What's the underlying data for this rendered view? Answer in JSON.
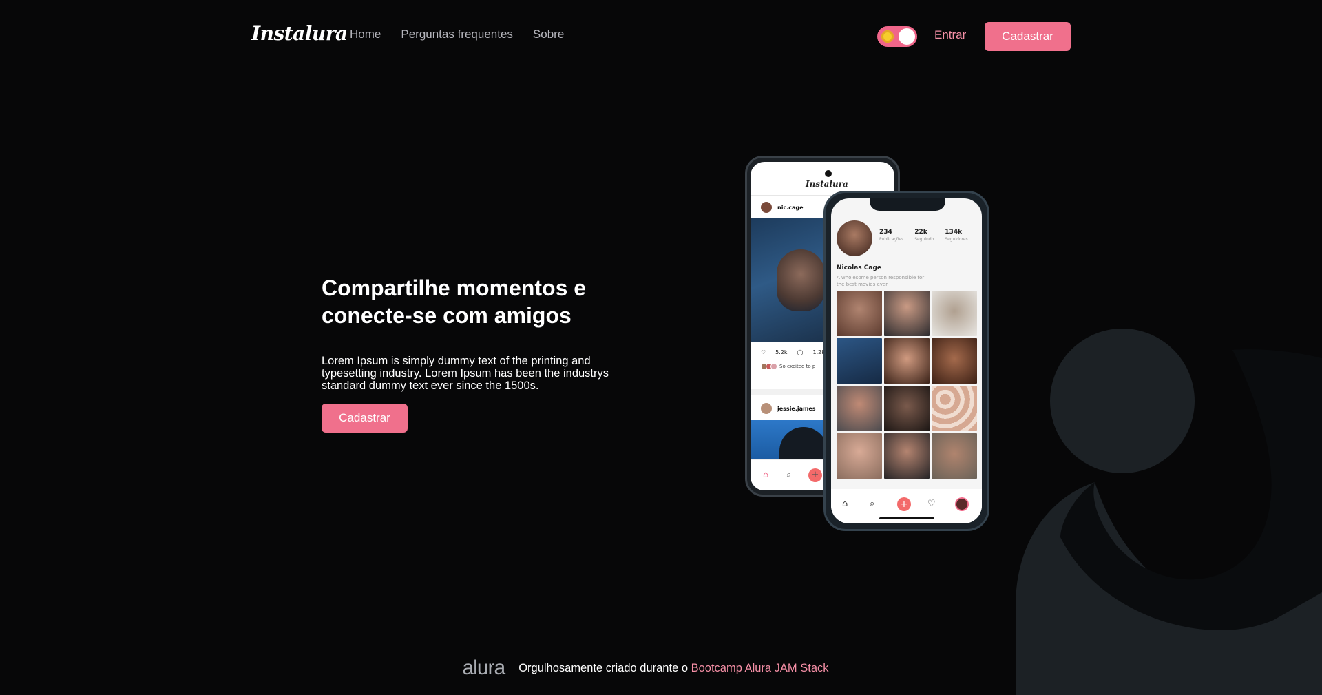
{
  "header": {
    "logo": "Instalura",
    "nav": [
      "Home",
      "Perguntas frequentes",
      "Sobre"
    ],
    "login": "Entrar",
    "signup": "Cadastrar"
  },
  "hero": {
    "title": "Compartilhe momentos e conecte-se com amigos",
    "description": "Lorem Ipsum is simply dummy text of the printing and typesetting industry. Lorem Ipsum has been the industrys standard dummy text ever since the 1500s.",
    "cta": "Cadastrar"
  },
  "phone_back": {
    "app_title": "Instalura",
    "user1": "nic.cage",
    "likes": "5.2k",
    "comments": "1.2k",
    "liked_text": "So excited to p",
    "user2": "jessie.james"
  },
  "phone_front": {
    "stats": [
      {
        "value": "234",
        "label": "Publicações"
      },
      {
        "value": "22k",
        "label": "Seguindo"
      },
      {
        "value": "134k",
        "label": "Seguidores"
      }
    ],
    "name": "Nicolas Cage",
    "bio": "A wholesome person responsible for the best movies ever."
  },
  "footer": {
    "brand": "alura",
    "text": "Orgulhosamente criado durante o ",
    "link": "Bootcamp Alura JAM Stack"
  },
  "colors": {
    "accent": "#f0708c",
    "background": "#070708",
    "decoration": "#1c2125"
  }
}
